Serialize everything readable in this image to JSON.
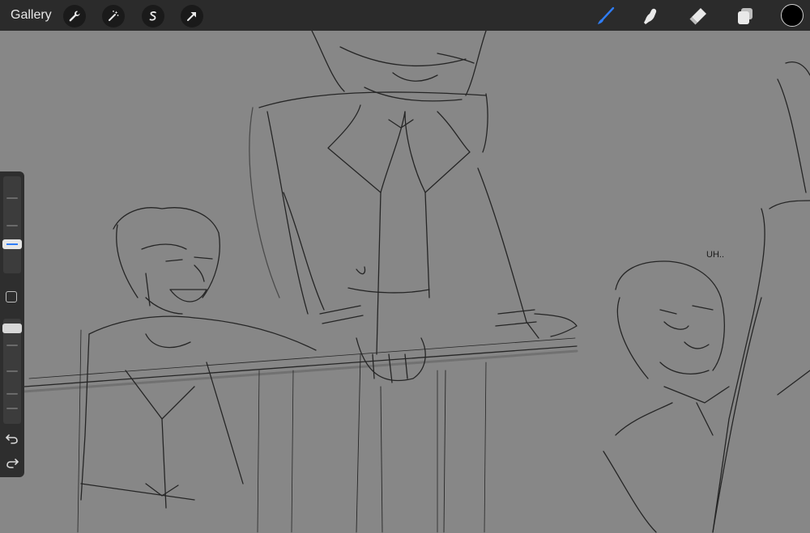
{
  "topbar": {
    "gallery_label": "Gallery",
    "left_tools": [
      {
        "name": "actions",
        "icon": "wrench-icon"
      },
      {
        "name": "adjustments",
        "icon": "magic-wand-icon"
      },
      {
        "name": "selection",
        "icon": "selection-s-icon"
      },
      {
        "name": "transform",
        "icon": "arrow-cursor-icon"
      }
    ],
    "right_tools": [
      {
        "name": "brush",
        "icon": "brush-icon",
        "active": true
      },
      {
        "name": "smudge",
        "icon": "smudge-finger-icon"
      },
      {
        "name": "eraser",
        "icon": "eraser-icon"
      },
      {
        "name": "layers",
        "icon": "layers-icon"
      }
    ],
    "current_color": "#000000",
    "accent_color": "#2f7df6"
  },
  "sidebar": {
    "brush_size_level": 0.4,
    "opacity_level": 1.0,
    "undo_icon": "undo-icon",
    "redo_icon": "redo-icon",
    "modify_icon": "modify-square-icon"
  },
  "canvas": {
    "sketch_annotation": "UH.."
  }
}
